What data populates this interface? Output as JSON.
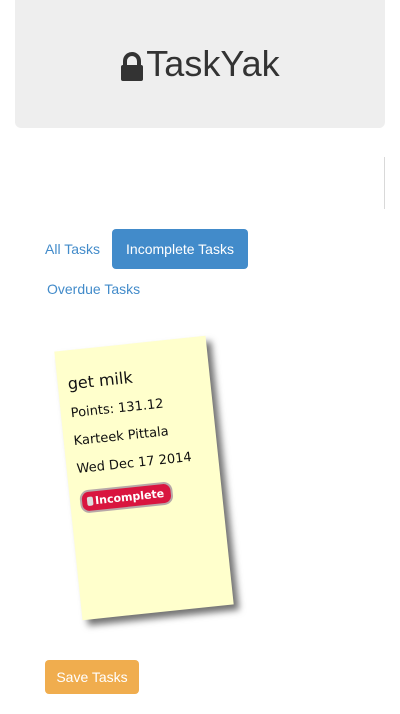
{
  "header": {
    "title": "TaskYak",
    "icon": "lock-icon"
  },
  "nav": {
    "all_tasks": "All Tasks",
    "incomplete_tasks": "Incomplete Tasks",
    "overdue_tasks": "Overdue Tasks"
  },
  "task": {
    "title": "get milk",
    "points": "Points: 131.12",
    "assignee": "Karteek Pittala",
    "date": "Wed Dec 17 2014",
    "status": "Incomplete"
  },
  "footer": {
    "save_label": "Save Tasks"
  },
  "colors": {
    "header_bg": "#eeeeee",
    "primary": "#428bca",
    "warning": "#f0ad4e",
    "note_bg": "#ffffcc",
    "badge": "#d9153f"
  }
}
